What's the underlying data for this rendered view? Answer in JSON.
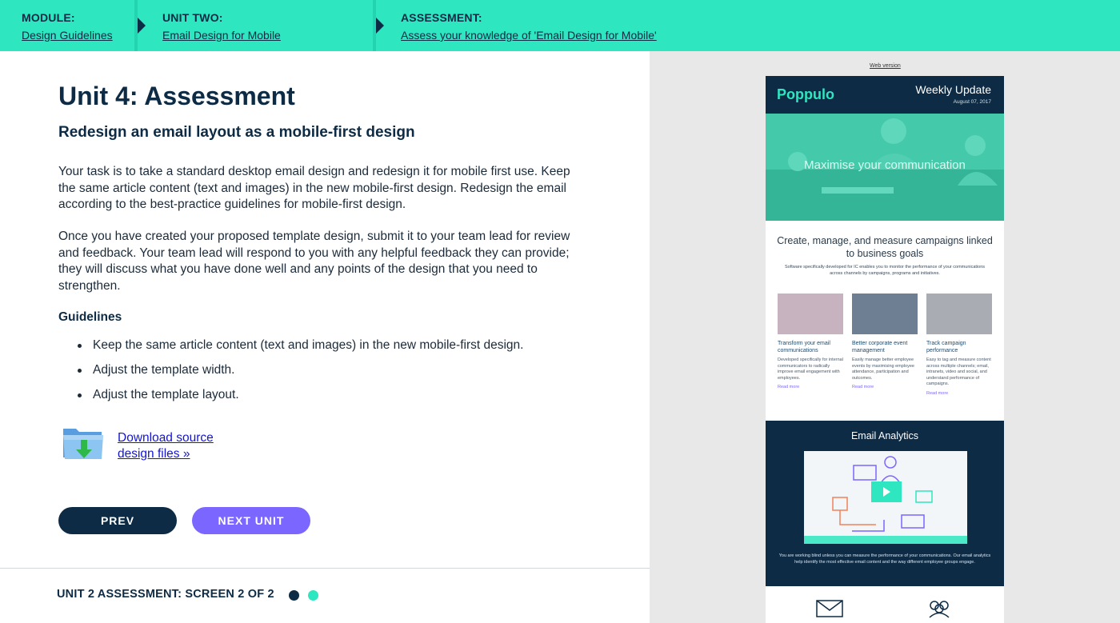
{
  "breadcrumb": {
    "module": {
      "kicker": "MODULE:",
      "link": "Design Guidelines"
    },
    "unit": {
      "kicker": "UNIT TWO:",
      "link": "Email Design for Mobile"
    },
    "assessment": {
      "kicker": "ASSESSMENT:",
      "link": "Assess your knowledge of 'Email Design for Mobile'"
    }
  },
  "main": {
    "title": "Unit 4: Assessment",
    "subtitle": "Redesign an email layout as a mobile-first design",
    "paragraph1": "Your task is to take a standard desktop email design and redesign it for mobile first use. Keep the same article content (text and images) in the new mobile-first design. Redesign the email according to the best-practice guidelines for mobile-first design.",
    "paragraph2": "Once you have created your proposed template design, submit it to your team lead for review and feedback. Your team lead will respond to you with any helpful feedback they can provide; they will discuss what you have done well and any points of the design that you need to strengthen.",
    "guidelines_title": "Guidelines",
    "guidelines": [
      "Keep the same article content (text and images) in the new mobile-first design.",
      "Adjust the template width.",
      "Adjust the template layout."
    ],
    "download_line1": "Download source ",
    "download_line2": "design files »"
  },
  "nav": {
    "prev": "PREV",
    "next": "NEXT UNIT"
  },
  "footer": {
    "label": "UNIT 2 ASSESSMENT: SCREEN 2 OF 2"
  },
  "preview": {
    "web_version": "Web version",
    "brand": "Poppulo",
    "weekly": "Weekly Update",
    "date": "August 07, 2017",
    "hero_text": "Maximise your communication",
    "tagline": "Create, manage, and measure campaigns linked to business goals",
    "tag_small": "Software specifically developed for IC enables you to monitor the performance of your communications across channels by campaigns, programs and initiatives.",
    "cards": [
      {
        "title": "Transform your email communications",
        "body": "Developed specifically for internal communicators to radically improve email engagement with employees.",
        "more": "Read more"
      },
      {
        "title": "Better corporate event management",
        "body": "Easily manage better employee events by maximising employee attendance, participation and outcomes.",
        "more": "Read more"
      },
      {
        "title": "Track campaign performance",
        "body": "Easy to tag and measure content across multiple channels; email, intranets, video and social, and understand performance of campaigns.",
        "more": "Read more"
      }
    ],
    "analytics_title": "Email Analytics",
    "analytics_text": "You are working blind unless you can measure the performance of your communications. Our email analytics help identify the most effective email content and the way different employee groups engage."
  },
  "colors": {
    "accent": "#2ee6c0",
    "navy": "#0d2b45",
    "purple": "#7b67ff"
  }
}
